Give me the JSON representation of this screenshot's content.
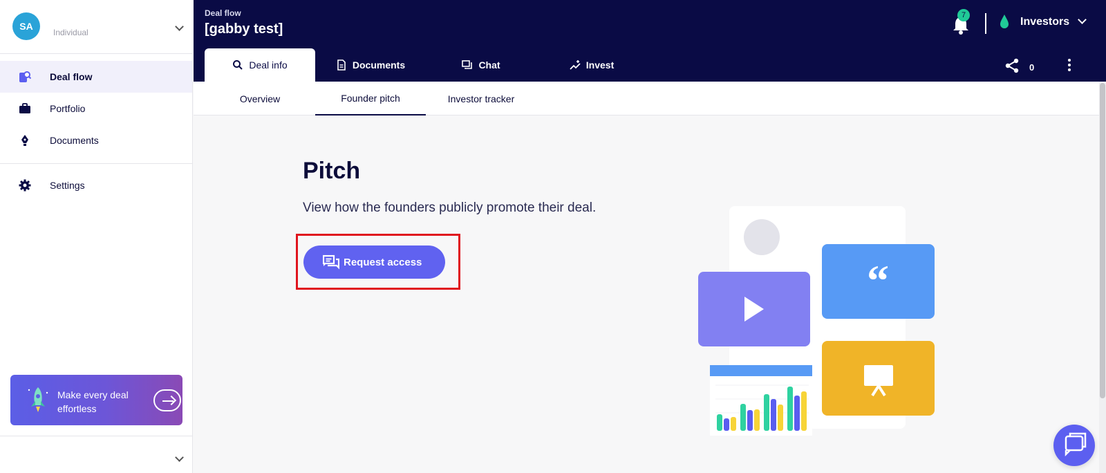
{
  "profile": {
    "initials": "SA",
    "type": "Individual"
  },
  "sidebar": {
    "items": [
      {
        "label": "Deal flow",
        "icon": "deal-flow-icon",
        "active": true
      },
      {
        "label": "Portfolio",
        "icon": "briefcase-icon"
      },
      {
        "label": "Documents",
        "icon": "pen-nib-icon"
      },
      {
        "label": "Settings",
        "icon": "gear-icon"
      }
    ],
    "promo": {
      "text": "Make every deal effortless"
    }
  },
  "header": {
    "breadcrumb": "Deal flow",
    "title": "[gabby test]",
    "notifications": "7",
    "workspace": "Investors",
    "share_count": "0",
    "tabs": [
      {
        "label": "Deal info",
        "icon": "search-icon",
        "active": true
      },
      {
        "label": "Documents",
        "icon": "document-icon"
      },
      {
        "label": "Chat",
        "icon": "chat-icon"
      },
      {
        "label": "Invest",
        "icon": "invest-icon"
      }
    ]
  },
  "subtabs": [
    {
      "label": "Overview"
    },
    {
      "label": "Founder pitch",
      "active": true
    },
    {
      "label": "Investor tracker"
    }
  ],
  "main": {
    "title": "Pitch",
    "description": "View how the founders publicly promote their deal.",
    "button_label": "Request access"
  },
  "colors": {
    "navy": "#0a0b45",
    "accent": "#6062f0",
    "badge": "#20c997",
    "highlight": "#e0141e"
  }
}
